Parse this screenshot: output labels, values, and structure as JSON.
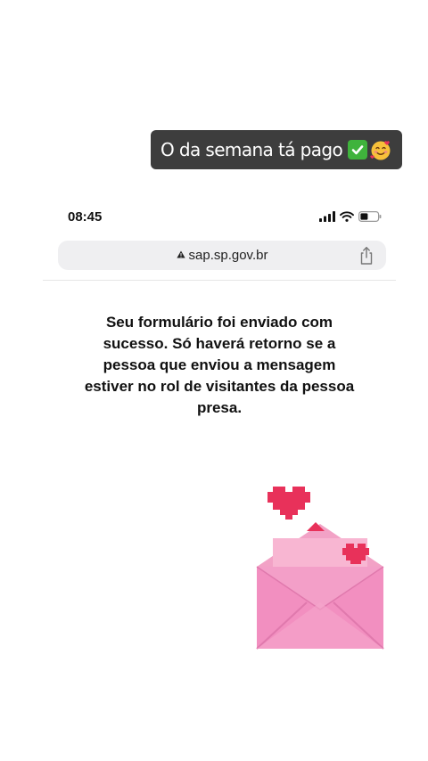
{
  "caption": {
    "text": "O da semana tá pago",
    "emoji_1": "check-mark-emoji",
    "emoji_2": "smiling-face-with-hearts-emoji",
    "background": "#3d3d3d"
  },
  "screenshot": {
    "status_bar": {
      "time": "08:45",
      "icons": [
        "signal-icon",
        "wifi-icon",
        "battery-icon"
      ]
    },
    "browser": {
      "url": "sap.sp.gov.br",
      "url_icon": "warning-icon",
      "share_icon": "share-icon"
    },
    "message": "Seu formulário foi enviado com sucesso. Só haverá retorno se a pessoa que enviou a mensagem estiver no rol de visitantes da pessoa presa.",
    "illustration": {
      "icon": "love-letter-envelope-icon",
      "colors": {
        "envelope": "#f28fc0",
        "heart": "#e8315a"
      }
    }
  }
}
